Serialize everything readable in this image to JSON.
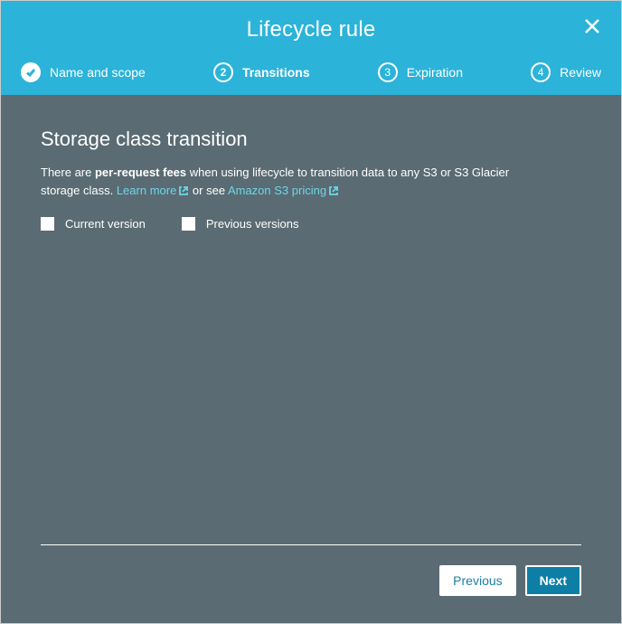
{
  "header": {
    "title": "Lifecycle rule"
  },
  "steps": [
    {
      "num": "1",
      "label": "Name and scope",
      "state": "completed"
    },
    {
      "num": "2",
      "label": "Transitions",
      "state": "active"
    },
    {
      "num": "3",
      "label": "Expiration",
      "state": ""
    },
    {
      "num": "4",
      "label": "Review",
      "state": ""
    }
  ],
  "section": {
    "title": "Storage class transition",
    "desc_pre": "There are ",
    "desc_bold": "per-request fees",
    "desc_mid": " when using lifecycle to transition data to any S3 or S3 Glacier storage class. ",
    "learn_more": "Learn more",
    "or_see": " or see ",
    "pricing": "Amazon S3 pricing"
  },
  "checkboxes": {
    "current": "Current version",
    "previous": "Previous versions"
  },
  "buttons": {
    "previous": "Previous",
    "next": "Next"
  }
}
